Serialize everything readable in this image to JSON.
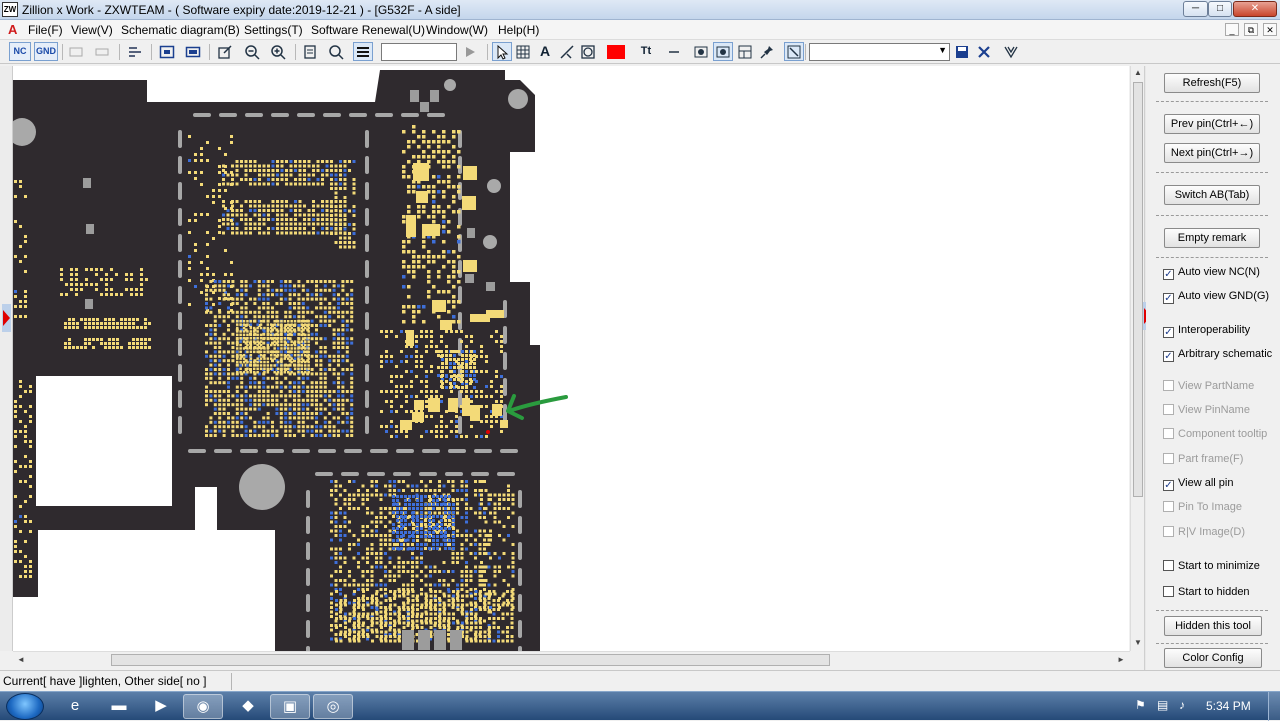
{
  "window": {
    "title": "Zillion x Work - ZXWTEAM - ( Software expiry date:2019-12-21 ) - [G532F - A side]",
    "app_icon": "ZW",
    "controls": [
      "─",
      "□",
      "✕"
    ]
  },
  "menubar": {
    "logo": "A",
    "items": [
      "File(F)",
      "View(V)",
      "Schematic diagram(B)",
      "Settings(T)",
      "Software Renewal(U)",
      "Window(W)",
      "Help(H)"
    ],
    "mdi_controls": [
      "_",
      "⧉",
      "✕"
    ]
  },
  "toolbar": {
    "nc_label": "NC",
    "gnd_label": "GND",
    "search_value": "",
    "text_tool_label": "Tt",
    "draw_color": "#ff0000",
    "combo_value": ""
  },
  "board": {
    "background": "#2f2a2e",
    "pad_color": "#f3da78",
    "pin_color": "#3e6fd9",
    "annotation_color": "#2a9b3e"
  },
  "panel": {
    "buttons": {
      "refresh": "Refresh(F5)",
      "prev_pin": "Prev pin(Ctrl+←)",
      "next_pin": "Next pin(Ctrl+→)",
      "switch_ab": "Switch AB(Tab)",
      "empty_remark": "Empty remark",
      "hidden_tool": "Hidden this tool",
      "color_config": "Color Config"
    },
    "options": [
      {
        "label": "Auto view NC(N)",
        "checked": true,
        "enabled": true
      },
      {
        "label": "Auto view GND(G)",
        "checked": true,
        "enabled": true
      },
      {
        "label": "Interoperability",
        "checked": true,
        "enabled": true
      },
      {
        "label": "Arbitrary schematic",
        "checked": true,
        "enabled": true
      },
      {
        "label": "View PartName",
        "checked": false,
        "enabled": false
      },
      {
        "label": "View PinName",
        "checked": false,
        "enabled": false
      },
      {
        "label": "Component tooltip",
        "checked": false,
        "enabled": false
      },
      {
        "label": "Part frame(F)",
        "checked": false,
        "enabled": false
      },
      {
        "label": "View all pin",
        "checked": true,
        "enabled": true
      },
      {
        "label": "Pin To Image",
        "checked": false,
        "enabled": false
      },
      {
        "label": "R|V Image(D)",
        "checked": false,
        "enabled": false
      },
      {
        "label": "Start to minimize",
        "checked": false,
        "enabled": true
      },
      {
        "label": "Start to hidden",
        "checked": false,
        "enabled": true
      }
    ]
  },
  "status": {
    "text": "Current[ have ]lighten,  Other side[ no ]"
  },
  "taskbar": {
    "time": "5:34 PM"
  }
}
